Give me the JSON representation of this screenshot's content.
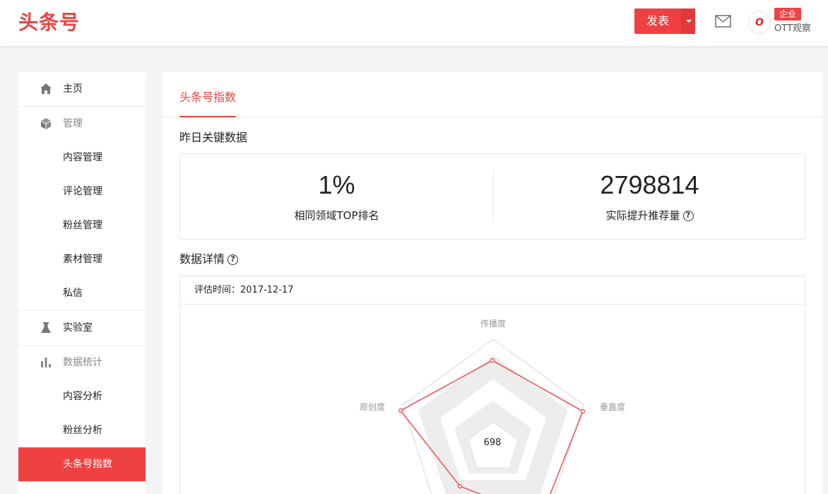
{
  "header": {
    "logo": "头条号",
    "publish_label": "发表",
    "badge": "企业",
    "account_name": "OTT观察",
    "avatar_text": "O"
  },
  "sidebar": {
    "items": [
      {
        "label": "主页",
        "icon": "home-icon"
      },
      {
        "label": "管理",
        "icon": "cube-icon"
      },
      {
        "label": "内容管理"
      },
      {
        "label": "评论管理"
      },
      {
        "label": "粉丝管理"
      },
      {
        "label": "素材管理"
      },
      {
        "label": "私信"
      },
      {
        "label": "实验室",
        "icon": "flask-icon"
      },
      {
        "label": "数据统计",
        "icon": "bar-chart-icon"
      },
      {
        "label": "内容分析"
      },
      {
        "label": "粉丝分析"
      },
      {
        "label": "头条号指数"
      }
    ]
  },
  "main": {
    "tab": "头条号指数",
    "key_title": "昨日关键数据",
    "stats": [
      {
        "value": "1%",
        "label": "相同领域TOP排名"
      },
      {
        "value": "2798814",
        "label": "实际提升推荐量"
      }
    ],
    "detail_title": "数据详情",
    "eval_label": "评估时间：2017-12-17",
    "radar": {
      "center_value": "698",
      "axes": [
        "传播度",
        "垂直度",
        "原创度"
      ]
    }
  },
  "colors": {
    "accent": "#f04142",
    "radar_line": "#f0575a"
  }
}
